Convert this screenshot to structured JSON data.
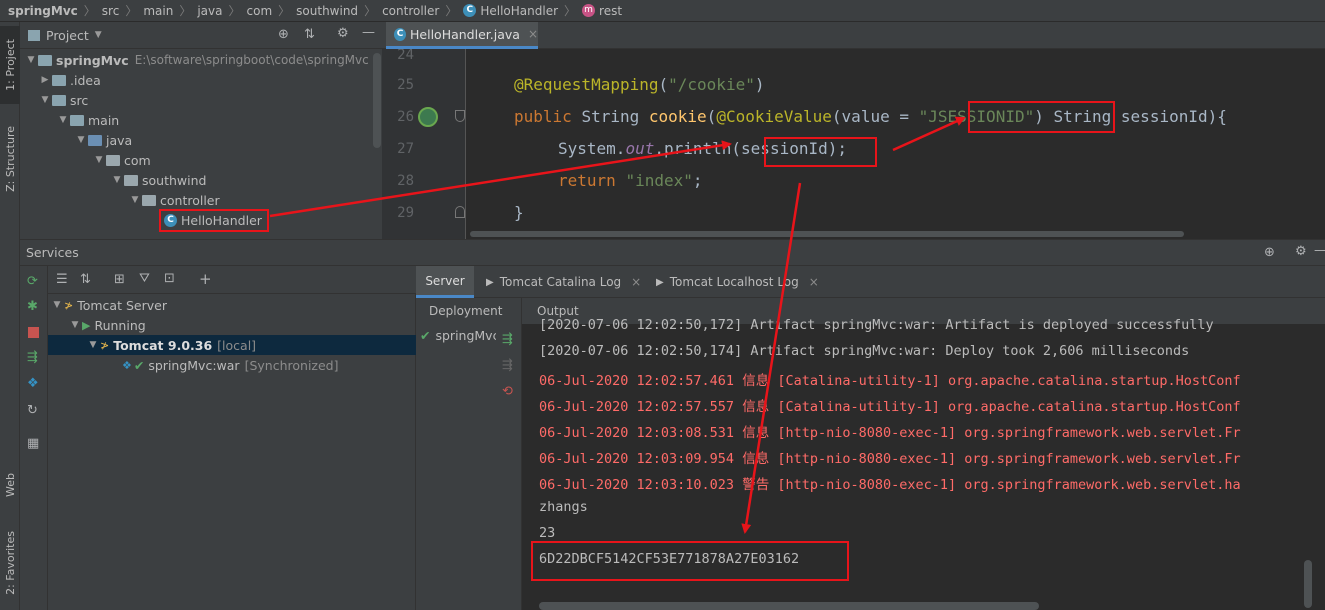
{
  "breadcrumb": [
    "springMvc",
    "src",
    "main",
    "java",
    "com",
    "southwind",
    "controller",
    "HelloHandler",
    "rest"
  ],
  "left_strip": {
    "project": "1: Project",
    "structure": "Z: Structure",
    "web": "Web",
    "favorites": "2: Favorites"
  },
  "project": {
    "title": "Project",
    "root_name": "springMvc",
    "root_path": "E:\\software\\springboot\\code\\springMvc",
    "items": [
      ".idea",
      "src",
      "main",
      "java",
      "com",
      "southwind",
      "controller",
      "HelloHandler"
    ]
  },
  "editor": {
    "tab": "HelloHandler.java",
    "line_numbers": [
      "24",
      "25",
      "26",
      "27",
      "28",
      "29"
    ],
    "code": {
      "l25_ann": "@RequestMapping",
      "l25_str": "\"/cookie\"",
      "l26_kw": "public",
      "l26_type": "String",
      "l26_fn": "cookie",
      "l26_ann": "@CookieValue",
      "l26_param": "value",
      "l26_str": "\"JSESSIONID\"",
      "l26_rest": "String sessionId){",
      "l27_sys": "System.",
      "l27_out": "out",
      "l27_call": ".println(sessionId);",
      "l28_kw": "return",
      "l28_str": "\"index\"",
      "l29": "}"
    }
  },
  "services": {
    "title": "Services",
    "tree": {
      "server": "Tomcat Server",
      "running": "Running",
      "tomcat": "Tomcat 9.0.36",
      "tomcat_tag": "[local]",
      "artifact": "springMvc:war",
      "artifact_tag": "[Synchronized]"
    },
    "tabs": [
      "Server",
      "Tomcat Catalina Log",
      "Tomcat Localhost Log"
    ],
    "deployment_label": "Deployment",
    "deployment_item": "springMvc",
    "output_label": "Output"
  },
  "log": [
    {
      "text": "[2020-07-06 12:02:50,172] Artifact springMvc:war: Artifact is deployed successfully",
      "color": "normal"
    },
    {
      "text": "[2020-07-06 12:02:50,174] Artifact springMvc:war: Deploy took 2,606 milliseconds",
      "color": "normal"
    },
    {
      "text": "06-Jul-2020 12:02:57.461 信息 [Catalina-utility-1] org.apache.catalina.startup.HostConf",
      "color": "red"
    },
    {
      "text": "06-Jul-2020 12:02:57.557 信息 [Catalina-utility-1] org.apache.catalina.startup.HostConf",
      "color": "red"
    },
    {
      "text": "06-Jul-2020 12:03:08.531 信息 [http-nio-8080-exec-1] org.springframework.web.servlet.Fr",
      "color": "red"
    },
    {
      "text": "06-Jul-2020 12:03:09.954 信息 [http-nio-8080-exec-1] org.springframework.web.servlet.Fr",
      "color": "red"
    },
    {
      "text": "06-Jul-2020 12:03:10.023 警告 [http-nio-8080-exec-1] org.springframework.web.servlet.ha",
      "color": "red"
    },
    {
      "text": "zhangs",
      "color": "normal"
    },
    {
      "text": "23",
      "color": "normal"
    },
    {
      "text": "6D22DBCF5142CF53E771878A27E03162",
      "color": "normal"
    }
  ],
  "colors": {
    "annotation_red": "#e8141a",
    "log_red": "#ff6b68",
    "running_green": "#59a869"
  }
}
